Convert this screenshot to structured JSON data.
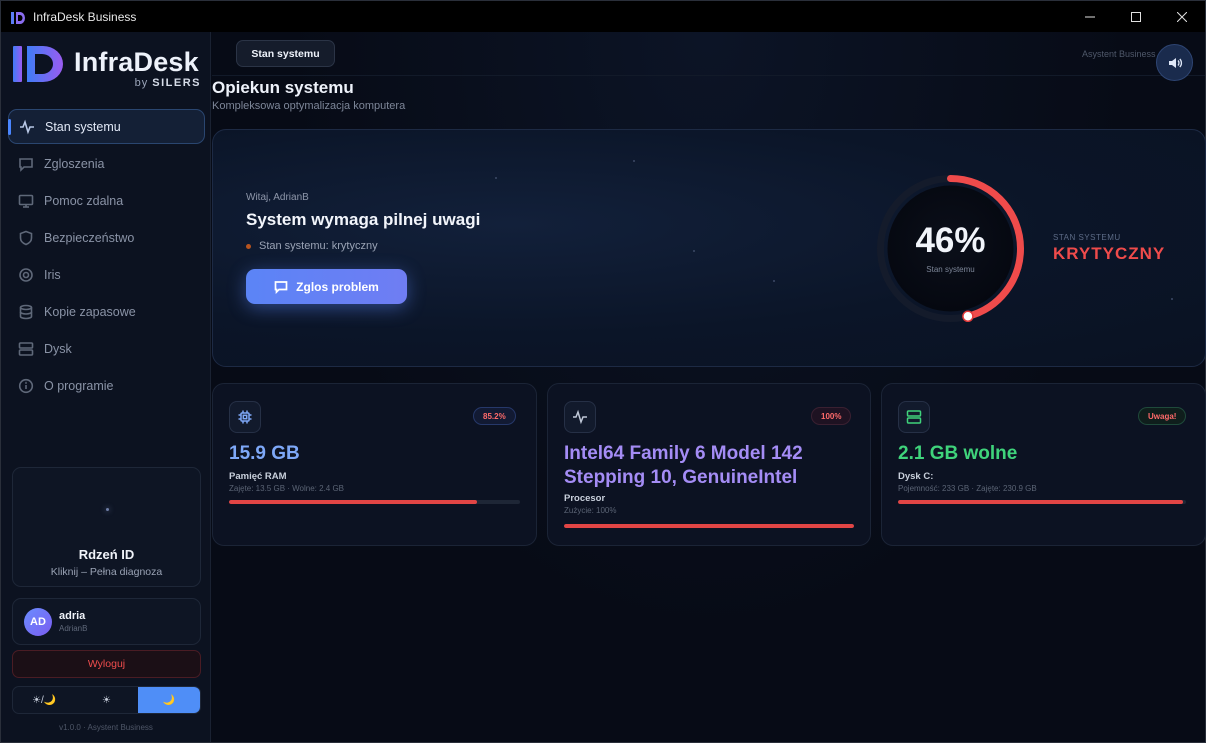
{
  "window": {
    "title": "InfraDesk Business"
  },
  "brand": {
    "name": "InfraDesk",
    "by": "by",
    "company": "SILERS"
  },
  "sidebar": {
    "items": [
      {
        "label": "Stan systemu",
        "icon": "activity-icon",
        "active": true
      },
      {
        "label": "Zgloszenia",
        "icon": "message-icon",
        "active": false
      },
      {
        "label": "Pomoc zdalna",
        "icon": "monitor-icon",
        "active": false
      },
      {
        "label": "Bezpieczeństwo",
        "icon": "shield-icon",
        "active": false
      },
      {
        "label": "Iris",
        "icon": "target-icon",
        "active": false
      },
      {
        "label": "Kopie zapasowe",
        "icon": "database-icon",
        "active": false
      },
      {
        "label": "Dysk",
        "icon": "server-icon",
        "active": false
      },
      {
        "label": "O programie",
        "icon": "info-icon",
        "active": false
      }
    ],
    "core": {
      "title": "Rdzeń ID",
      "subtitle": "Kliknij – Pełna diagnoza"
    },
    "user": {
      "initials": "AD",
      "name": "adria",
      "login": "AdrianB"
    },
    "logout_label": "Wyloguj",
    "theme_options": [
      "☀/🌙",
      "☀",
      "🌙"
    ],
    "theme_active": 2,
    "version": "v1.0.0 · Asystent Business"
  },
  "header": {
    "tab_label": "Stan systemu",
    "assistant_label": "Asystent Business ·",
    "sound_icon": "speaker-icon"
  },
  "page": {
    "title": "Opiekun systemu",
    "subtitle": "Kompleksowa optymalizacja komputera"
  },
  "hero": {
    "greeting": "Witaj, AdrianB",
    "title": "System wymaga pilnej uwagi",
    "status": "Stan systemu: krytyczny",
    "report_button": "Zglos problem",
    "gauge_value": "46%",
    "gauge_label": "Stan systemu",
    "gauge_fraction": 0.46,
    "state_caption": "STAN SYSTEMU",
    "state_value": "KRYTYCZNY"
  },
  "cards": {
    "ram": {
      "badge": "85.2%",
      "value": "15.9 GB",
      "label": "Pamięć RAM",
      "detail": "Zajęte: 13.5 GB · Wolne: 2.4 GB",
      "fill": 0.852,
      "color": "#7ea8f8"
    },
    "cpu": {
      "badge": "100%",
      "value_line1": "Intel64 Family 6 Model 142",
      "value_line2": "Stepping 10, GenuineIntel",
      "label": "Procesor",
      "detail": "Zużycie: 100%",
      "fill": 1.0,
      "color": "#a48cf5"
    },
    "disk": {
      "badge": "Uwaga!",
      "value": "2.1 GB wolne",
      "label": "Dysk C:",
      "detail": "Pojemność: 233 GB · Zajęte: 230.9 GB",
      "fill": 0.991,
      "color": "#3fd37b"
    }
  },
  "colors": {
    "accent": "#4f8ef7",
    "critical": "#ef4b4b",
    "bar": "#e24545"
  }
}
